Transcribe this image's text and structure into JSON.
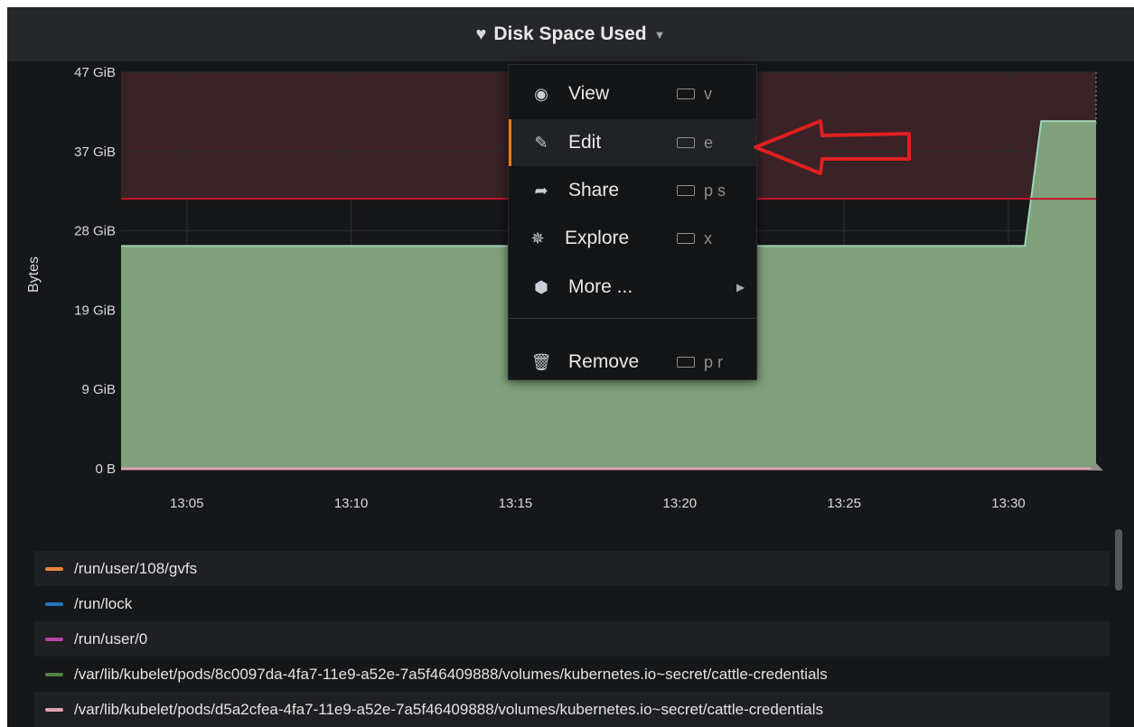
{
  "panel": {
    "title": "Disk Space Used"
  },
  "chart_data": {
    "type": "area",
    "ylabel": "Bytes",
    "y_ticks": [
      "47 GiB",
      "37 GiB",
      "28 GiB",
      "19 GiB",
      "9 GiB",
      "0 B"
    ],
    "x_ticks": [
      "13:05",
      "13:10",
      "13:15",
      "13:20",
      "13:25",
      "13:30"
    ],
    "ylim_gib": [
      0,
      47
    ],
    "threshold_gib": 32,
    "series": [
      {
        "name": "/var/lib/kubelet/pods/8c0097da-4fa7-11e9-a52e-7a5f46409888/volumes/kubernetes.io~secret/cattle-credentials",
        "color": "#7eb26d",
        "points": [
          [
            "13:03",
            26.4
          ],
          [
            "13:30:30",
            26.4
          ],
          [
            "13:31",
            41.2
          ],
          [
            "13:32:40",
            41.2
          ]
        ]
      },
      {
        "name": "/var/lib/kubelet/pods/d5a2cfea-4fa7-11e9-a52e-7a5f46409888/volumes/kubernetes.io~secret/cattle-credentials",
        "color": "#e0a3b3",
        "points": [
          [
            "13:03",
            0
          ],
          [
            "13:32:40",
            0
          ]
        ]
      }
    ],
    "grid": true
  },
  "legend": [
    {
      "label": "/run/user/108/gvfs",
      "color": "#ef843c"
    },
    {
      "label": "/run/lock",
      "color": "#1f78c1"
    },
    {
      "label": "/run/user/0",
      "color": "#ba43a9"
    },
    {
      "label": "/var/lib/kubelet/pods/8c0097da-4fa7-11e9-a52e-7a5f46409888/volumes/kubernetes.io~secret/cattle-credentials",
      "color": "#508642"
    },
    {
      "label": "/var/lib/kubelet/pods/d5a2cfea-4fa7-11e9-a52e-7a5f46409888/volumes/kubernetes.io~secret/cattle-credentials",
      "color": "#e0a3b3"
    }
  ],
  "menu": {
    "view": {
      "label": "View",
      "shortcut": "v",
      "icon": "eye-icon"
    },
    "edit": {
      "label": "Edit",
      "shortcut": "e",
      "icon": "edit-icon"
    },
    "share": {
      "label": "Share",
      "shortcut": "p s",
      "icon": "share-icon"
    },
    "explore": {
      "label": "Explore",
      "shortcut": "x",
      "icon": "compass-icon"
    },
    "more": {
      "label": "More ...",
      "icon": "cube-icon"
    },
    "remove": {
      "label": "Remove",
      "shortcut": "p r",
      "icon": "trash-icon"
    }
  },
  "colors": {
    "threshold_line": "#c4162a",
    "threshold_fill": "#3a2226",
    "area_fill": "#7ea07a",
    "area_line": "#9ed4b8",
    "annotation_arrow": "#e02020",
    "accent": "#eb7b18"
  }
}
